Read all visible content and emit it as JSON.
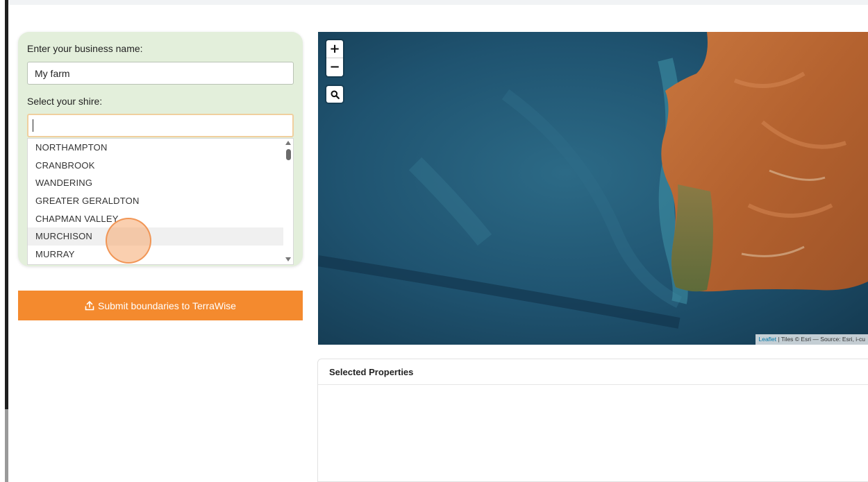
{
  "form": {
    "business_label": "Enter your business name:",
    "business_value": "My farm",
    "shire_label": "Select your shire:",
    "shire_value": "",
    "shire_options": [
      "NORTHAMPTON",
      "CRANBROOK",
      "WANDERING",
      "GREATER GERALDTON",
      "CHAPMAN VALLEY",
      "MURCHISON",
      "MURRAY"
    ],
    "hovered_option": "MURCHISON"
  },
  "submit": {
    "label": "Submit boundaries to TerraWise",
    "icon": "upload-icon",
    "color": "#f48a2e"
  },
  "map": {
    "zoom_in": "+",
    "zoom_out": "−",
    "search_icon": "magnifier-icon",
    "attribution_link": "Leaflet",
    "attribution_text": " | Tiles © Esri — Source: Esri, i-cu"
  },
  "properties": {
    "title": "Selected Properties"
  },
  "colors": {
    "form_bg": "#e3efdb",
    "accent": "#f48a2e",
    "ocean": "#1d4b63",
    "land": "#b8683a"
  }
}
